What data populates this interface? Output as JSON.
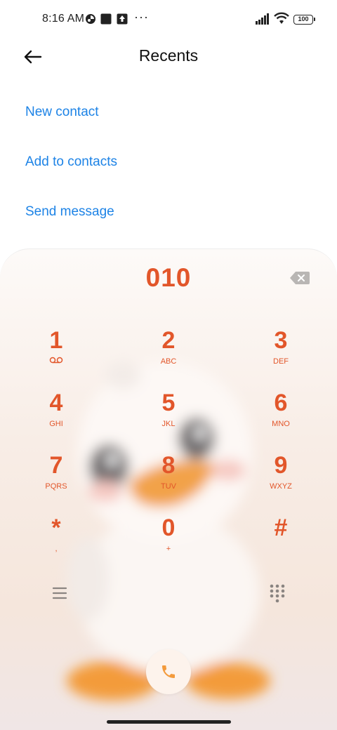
{
  "status_bar": {
    "time": "8:16 AM",
    "overflow": "···",
    "battery": "100",
    "icons": [
      "notification-app-icon",
      "square-icon",
      "upload-icon",
      "signal-icon",
      "wifi-icon",
      "battery-icon"
    ]
  },
  "header": {
    "title": "Recents",
    "back_icon": "arrow-left-icon"
  },
  "actions": {
    "new_contact": "New contact",
    "add_to_contacts": "Add to contacts",
    "send_message": "Send message"
  },
  "dialer": {
    "number": "010",
    "keys": [
      {
        "digit": "1",
        "letters": ""
      },
      {
        "digit": "2",
        "letters": "ABC"
      },
      {
        "digit": "3",
        "letters": "DEF"
      },
      {
        "digit": "4",
        "letters": "GHI"
      },
      {
        "digit": "5",
        "letters": "JKL"
      },
      {
        "digit": "6",
        "letters": "MNO"
      },
      {
        "digit": "7",
        "letters": "PQRS"
      },
      {
        "digit": "8",
        "letters": "TUV"
      },
      {
        "digit": "9",
        "letters": "WXYZ"
      },
      {
        "digit": "*",
        "letters": ","
      },
      {
        "digit": "0",
        "letters": "+"
      },
      {
        "digit": "#",
        "letters": ""
      }
    ],
    "accent_color": "#e2562a",
    "link_color": "#1d83e6"
  }
}
